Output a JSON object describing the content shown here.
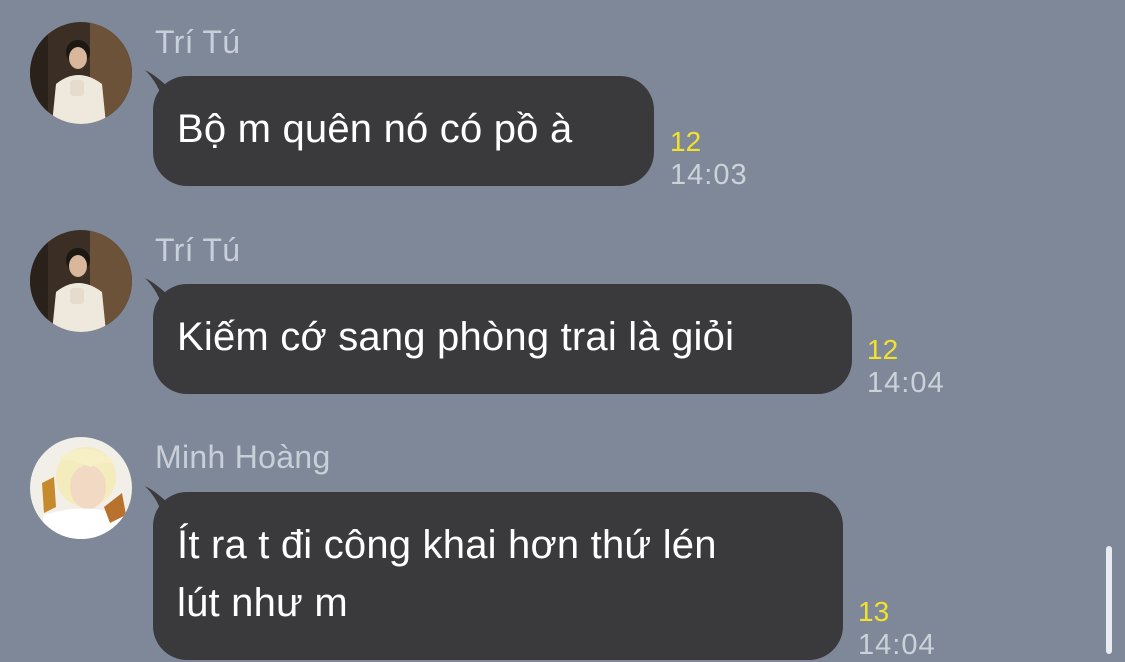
{
  "messages": [
    {
      "sender": "Trí Tú",
      "avatar_icon": "profile-photo-icon",
      "lines": [
        "Bộ m quên nó có pồ à"
      ],
      "read_count": "12",
      "time": "14:03"
    },
    {
      "sender": "Trí Tú",
      "avatar_icon": "profile-photo-icon",
      "lines": [
        "Kiếm cớ sang phòng trai là giỏi"
      ],
      "read_count": "12",
      "time": "14:04"
    },
    {
      "sender": "Minh Hoàng",
      "avatar_icon": "profile-photo-icon",
      "lines": [
        "Ít ra t đi công khai hơn thứ lén",
        "lút như m"
      ],
      "read_count": "13",
      "time": "14:04"
    }
  ],
  "colors": {
    "background": "#7e8899",
    "bubble": "#3a3a3d",
    "read_count": "#f3e22b",
    "meta_text": "#cdd2da"
  }
}
